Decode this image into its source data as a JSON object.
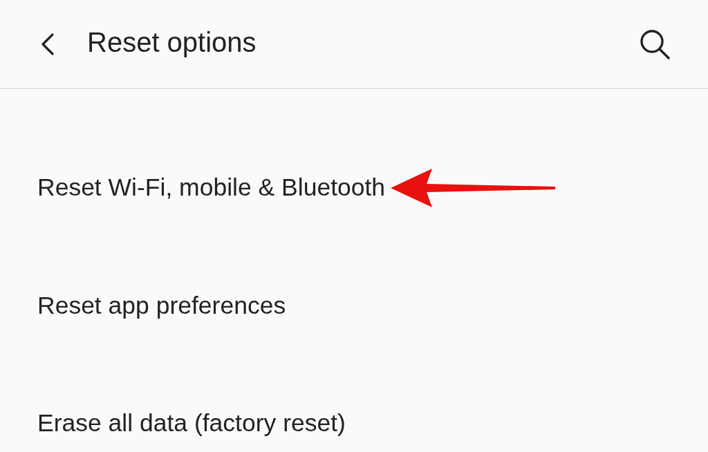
{
  "header": {
    "title": "Reset options"
  },
  "items": [
    {
      "label": "Reset Wi-Fi, mobile & Bluetooth",
      "pointed_at": true
    },
    {
      "label": "Reset app preferences",
      "pointed_at": false
    },
    {
      "label": "Erase all data (factory reset)",
      "pointed_at": false
    }
  ]
}
